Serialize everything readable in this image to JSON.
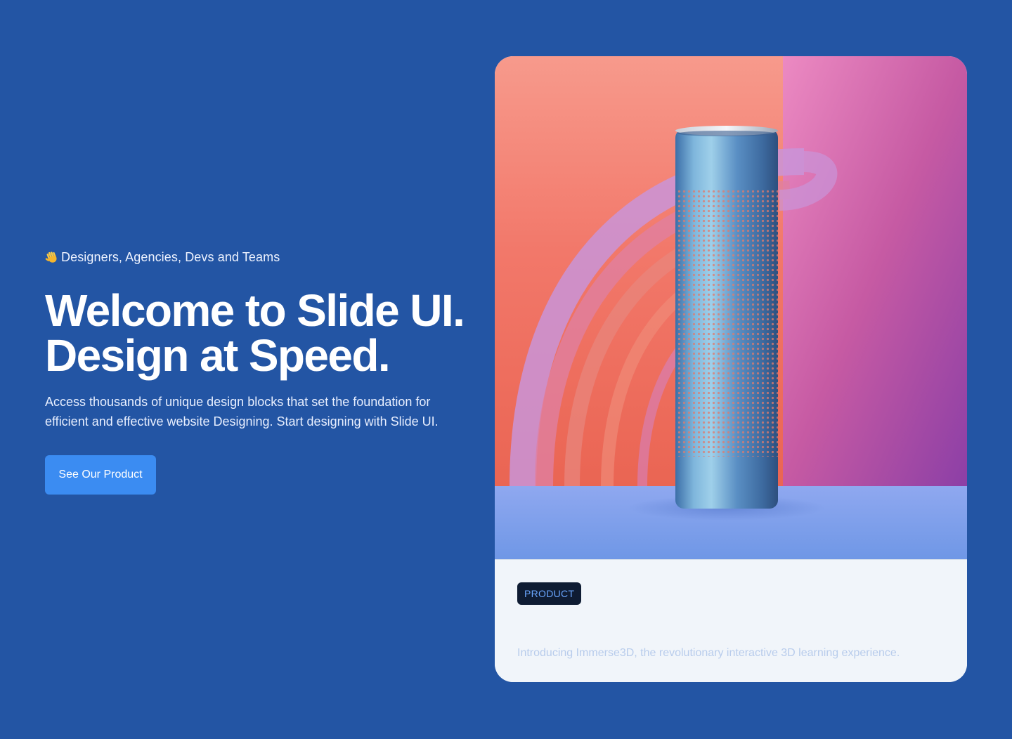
{
  "colors": {
    "page_background": "#2355a4",
    "button_background": "#3b8cf2",
    "card_background": "#f1f5fa",
    "badge_background": "#0f1c33",
    "badge_text": "#6aa6ff"
  },
  "hero": {
    "eyebrow_icon": "waving-hand-icon",
    "eyebrow_text": "Designers, Agencies, Devs and Teams",
    "headline_line1": "Welcome to Slide UI.",
    "headline_line2": "Design at Speed.",
    "subtext": "Access thousands of unique design blocks that set the foundation for efficient and effective website Designing. Start designing with Slide UI.",
    "cta_label": "See Our Product"
  },
  "card": {
    "image_subject": "cylindrical-speaker-product-image",
    "badge_label": "PRODUCT",
    "description": "Introducing Immerse3D, the revolutionary interactive 3D learning experience."
  }
}
